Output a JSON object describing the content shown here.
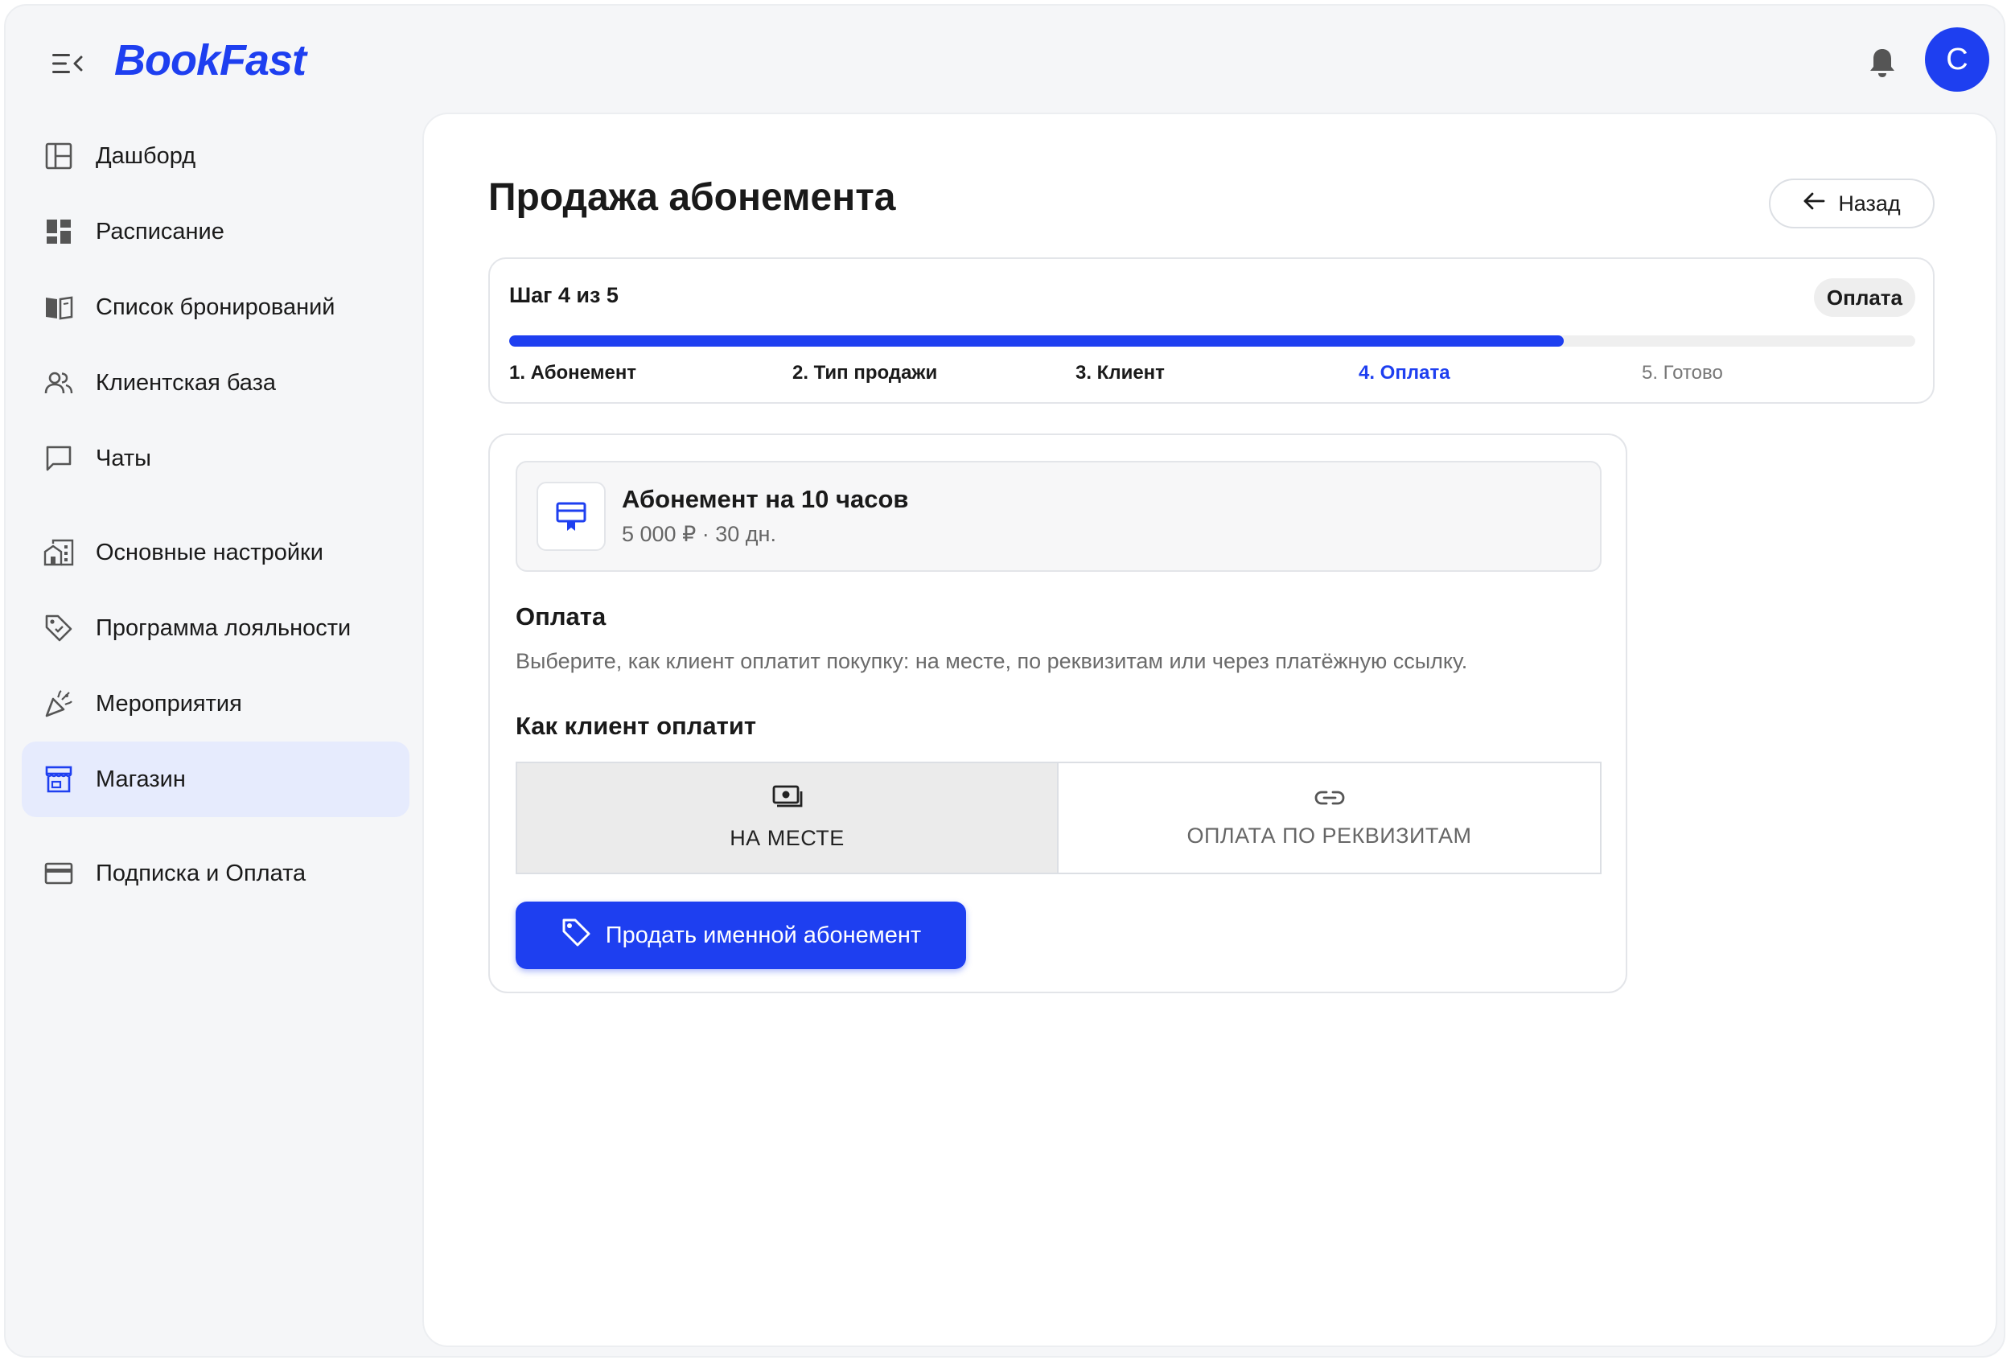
{
  "app": {
    "logo_text": "BookFast",
    "avatar_initial": "C",
    "brand_color": "#1e3ff0"
  },
  "sidebar": {
    "items": [
      {
        "label": "Дашборд",
        "icon": "dashboard-icon"
      },
      {
        "label": "Расписание",
        "icon": "schedule-grid-icon"
      },
      {
        "label": "Список бронирований",
        "icon": "book-icon"
      },
      {
        "label": "Клиентская база",
        "icon": "users-icon"
      },
      {
        "label": "Чаты",
        "icon": "chat-icon"
      },
      {
        "label": "Основные настройки",
        "icon": "building-icon"
      },
      {
        "label": "Программа лояльности",
        "icon": "tag-icon"
      },
      {
        "label": "Мероприятия",
        "icon": "party-icon"
      },
      {
        "label": "Магазин",
        "icon": "store-icon",
        "active": true
      },
      {
        "label": "Подписка и Оплата",
        "icon": "card-icon"
      }
    ]
  },
  "main": {
    "title": "Продажа абонемента",
    "back_label": "Назад",
    "stepper": {
      "count_text": "Шаг 4 из 5",
      "badge": "Оплата",
      "progress": 0.75,
      "steps": [
        "1. Абонемент",
        "2. Тип продажи",
        "3. Клиент",
        "4. Оплата",
        "5. Готово"
      ]
    },
    "product": {
      "name": "Абонемент на 10 часов",
      "meta": "5 000 ₽ · 30 дн."
    },
    "payment": {
      "title": "Оплата",
      "description": "Выберите, как клиент оплатит покупку: на месте, по реквизитам или через платёжную ссылку.",
      "how_title": "Как клиент оплатит",
      "options": [
        {
          "label": "НА МЕСТЕ",
          "icon": "cash-icon",
          "selected": true
        },
        {
          "label": "ОПЛАТА ПО РЕКВИЗИТАМ",
          "icon": "link-icon",
          "selected": false
        }
      ],
      "submit_label": "Продать именной абонемент"
    }
  }
}
